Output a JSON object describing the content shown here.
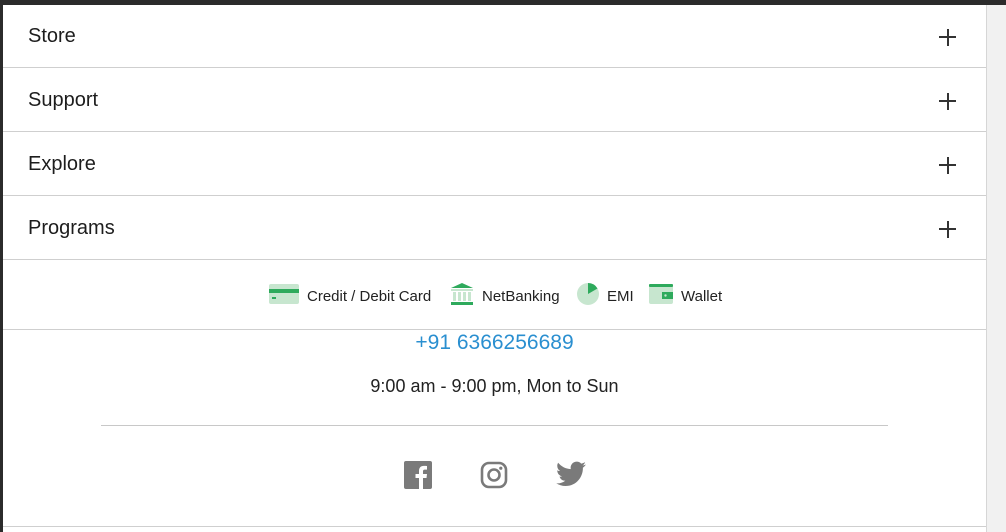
{
  "accordion": {
    "items": [
      {
        "label": "Store"
      },
      {
        "label": "Support"
      },
      {
        "label": "Explore"
      },
      {
        "label": "Programs"
      }
    ]
  },
  "payments": {
    "methods": [
      {
        "label": "Credit / Debit Card",
        "icon": "credit-card-icon"
      },
      {
        "label": "NetBanking",
        "icon": "bank-icon"
      },
      {
        "label": "EMI",
        "icon": "pie-chart-icon"
      },
      {
        "label": "Wallet",
        "icon": "wallet-icon"
      }
    ],
    "accent_color": "#2eaa5c",
    "icon_bg_color": "#c7e6cf"
  },
  "contact": {
    "phone": "+91 6366256689",
    "hours": "9:00 am - 9:00 pm, Mon to Sun",
    "phone_color": "#2a8fd0"
  },
  "social": {
    "links": [
      {
        "icon": "facebook-icon"
      },
      {
        "icon": "instagram-icon"
      },
      {
        "icon": "twitter-icon"
      }
    ],
    "icon_color": "#7a7a7a"
  }
}
